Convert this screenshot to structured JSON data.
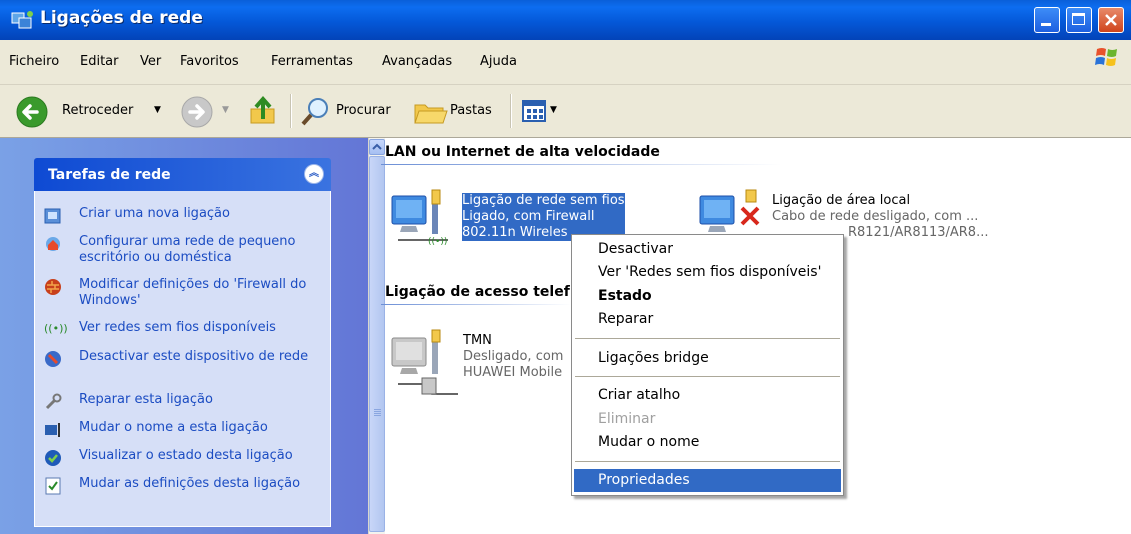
{
  "window": {
    "title": "Ligações de rede"
  },
  "menu": [
    "Ficheiro",
    "Editar",
    "Ver",
    "Favoritos",
    "Ferramentas",
    "Avançadas",
    "Ajuda"
  ],
  "toolbar": {
    "back_label": "Retroceder",
    "search_label": "Procurar",
    "folders_label": "Pastas"
  },
  "tasks": {
    "header": "Tarefas de rede",
    "items": [
      {
        "label": "Criar uma nova ligação",
        "icon": "new-connection-icon"
      },
      {
        "label": "Configurar uma rede de pequeno escritório ou doméstica",
        "icon": "home-network-icon"
      },
      {
        "label": "Modificar definições do 'Firewall do Windows'",
        "icon": "firewall-icon"
      },
      {
        "label": "Ver redes sem fios disponíveis",
        "icon": "wireless-icon"
      },
      {
        "label": "Desactivar este dispositivo de rede",
        "icon": "disable-device-icon"
      },
      {
        "label": "Reparar esta ligação",
        "icon": "repair-icon"
      },
      {
        "label": "Mudar o nome a esta ligação",
        "icon": "rename-icon"
      },
      {
        "label": "Visualizar o estado desta ligação",
        "icon": "status-icon"
      },
      {
        "label": "Mudar as definições desta ligação",
        "icon": "settings-icon"
      }
    ]
  },
  "groups": {
    "lan_header": "LAN ou Internet de alta velocidade",
    "dialup_header": "Ligação de acesso telef"
  },
  "connections": {
    "wireless": {
      "name": "Ligação de rede sem fios",
      "status": "Ligado, com Firewall",
      "device": "802.11n Wireles"
    },
    "local": {
      "name": "Ligação de área local",
      "status": "Cabo de rede desligado, com ...",
      "device": "R8121/AR8113/AR8..."
    },
    "tmn": {
      "name": "TMN",
      "status": "Desligado, com",
      "device": "HUAWEI Mobile"
    }
  },
  "context_menu": {
    "items": [
      {
        "label": "Desactivar"
      },
      {
        "label": "Ver 'Redes sem fios disponíveis'"
      },
      {
        "label": "Estado"
      },
      {
        "label": "Reparar"
      },
      {
        "label": "Ligações bridge"
      },
      {
        "label": "Criar atalho"
      },
      {
        "label": "Eliminar"
      },
      {
        "label": "Mudar o nome"
      },
      {
        "label": "Propriedades"
      }
    ]
  },
  "colors": {
    "titlebar": "#0458d8",
    "selection": "#316ac5",
    "task_link": "#1b4cc2",
    "task_pane": "#d6dff7"
  }
}
